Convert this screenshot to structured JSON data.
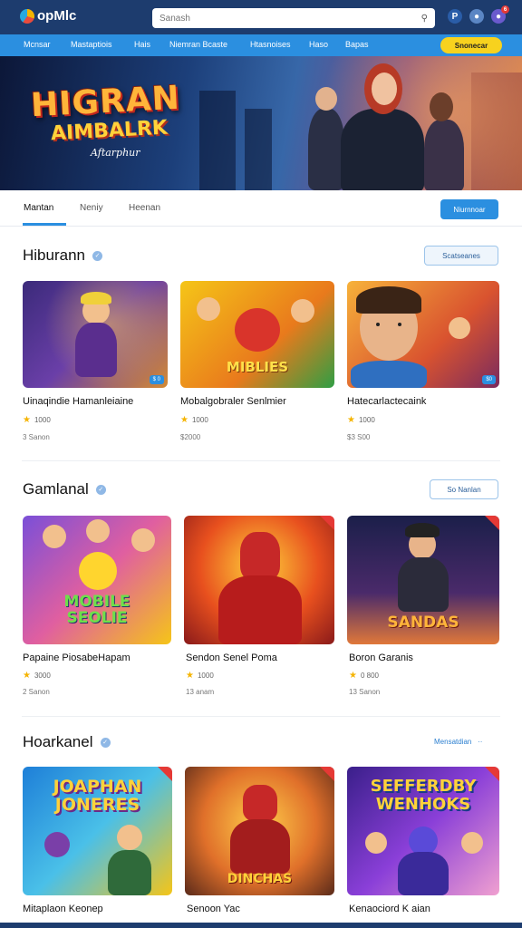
{
  "header": {
    "app_name": "opMlc",
    "search_placeholder": "Sanash",
    "icons": [
      "search-icon",
      "profile-icon",
      "globe-icon",
      "notification-icon"
    ],
    "notification_count": "6"
  },
  "nav": {
    "items": [
      "Mcnsar",
      "Mastaptiois",
      "Hais",
      "Niemran Bcaste",
      "Htasnoises",
      "Haso",
      "Bapas"
    ],
    "cta_label": "Snonecar"
  },
  "hero": {
    "title": "HIGRAN",
    "subtitle": "AIMBALRK",
    "tagline": "Aftarphur"
  },
  "tabs": {
    "items": [
      "Mantan",
      "Neniy",
      "Heenan"
    ],
    "active_index": 0,
    "button_label": "Niurnnoar"
  },
  "sections": [
    {
      "title": "Hiburann",
      "action_label": "Scatseanes",
      "cards": [
        {
          "title": "Uinaqindie Hamanleiaine",
          "rating": "1000",
          "meta": "3 Sanon",
          "badge": "$ 0",
          "art_text": ""
        },
        {
          "title": "Mobalgobraler Senlmier",
          "rating": "1000",
          "meta": "$2000",
          "badge": "",
          "art_text": "MIBLIES"
        },
        {
          "title": "Hatecarlactecaink",
          "rating": "1000",
          "meta": "$3 S00",
          "badge": "$0",
          "art_text": ""
        }
      ]
    },
    {
      "title": "Gamlanal",
      "action_label": "So Nanlan",
      "cards": [
        {
          "title": "Papaine PiosabeHapam",
          "rating": "3000",
          "meta": "2 Sanon",
          "badge": "",
          "art_text": "MOBILE SEOLIE"
        },
        {
          "title": "Sendon Senel Poma",
          "rating": "1000",
          "meta": "13 anam",
          "badge": "",
          "art_text": ""
        },
        {
          "title": "Boron Garanis",
          "rating": "0 800",
          "meta": "13 Sanon",
          "badge": "",
          "art_text": "SANDAS"
        }
      ]
    },
    {
      "title": "Hoarkanel",
      "action_label": "Mensatdian",
      "cards": [
        {
          "title": "Mitaplaon Keonep",
          "rating": "",
          "meta": "",
          "badge": "",
          "art_text": "JOAPHAN JONERES"
        },
        {
          "title": "Senoon Yac",
          "rating": "",
          "meta": "",
          "badge": "",
          "art_text": "DINCHAS"
        },
        {
          "title": "Kenaociord K aian",
          "rating": "",
          "meta": "",
          "badge": "",
          "art_text": "SEFFERDBY WENHOKS"
        }
      ]
    }
  ],
  "colors": {
    "header_bg": "#1d3c6e",
    "nav_bg": "#2b8fe0",
    "accent_yellow": "#f7d21e",
    "star": "#f5b400",
    "corner_badge": "#e53935"
  }
}
